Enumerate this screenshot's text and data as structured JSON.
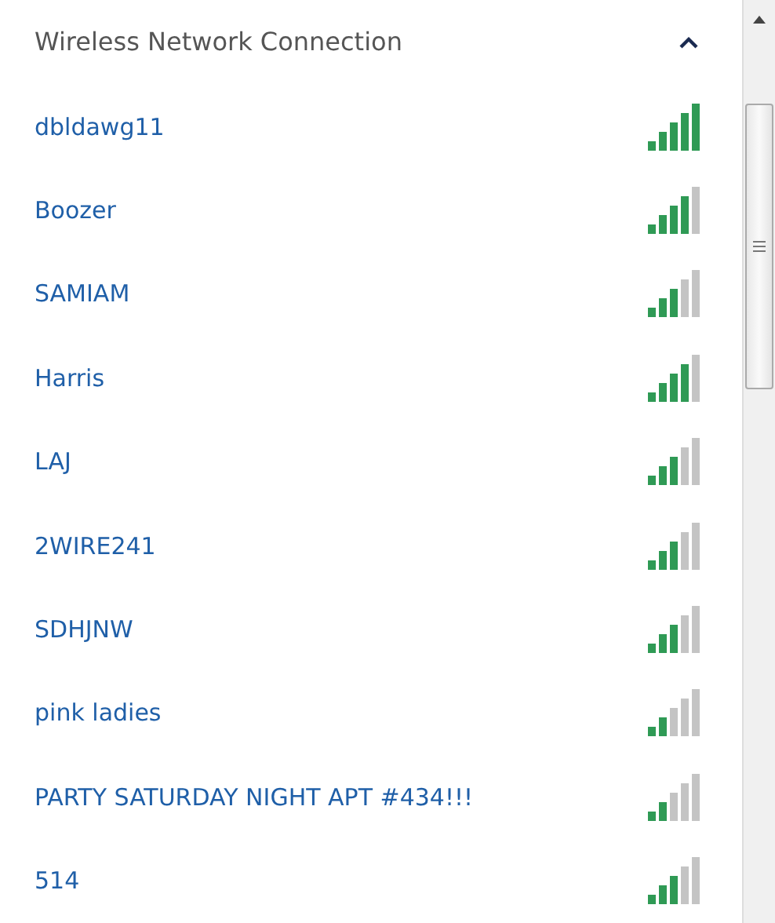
{
  "header": {
    "title": "Wireless Network Connection",
    "expanded": true
  },
  "networks": [
    {
      "name": "dbldawg11",
      "kind": "excellent"
    },
    {
      "name": "Boozer",
      "kind": "good"
    },
    {
      "name": "SAMIAM",
      "kind": "fair"
    },
    {
      "name": "Harris",
      "kind": "good"
    },
    {
      "name": "LAJ",
      "kind": "fair"
    },
    {
      "name": "2WIRE241",
      "kind": "fair"
    },
    {
      "name": "SDHJNW",
      "kind": "fair"
    },
    {
      "name": "pink ladies",
      "kind": "weak"
    },
    {
      "name": "PARTY SATURDAY NIGHT APT #434!!!",
      "kind": "weak"
    },
    {
      "name": "514",
      "kind": "fair"
    }
  ]
}
